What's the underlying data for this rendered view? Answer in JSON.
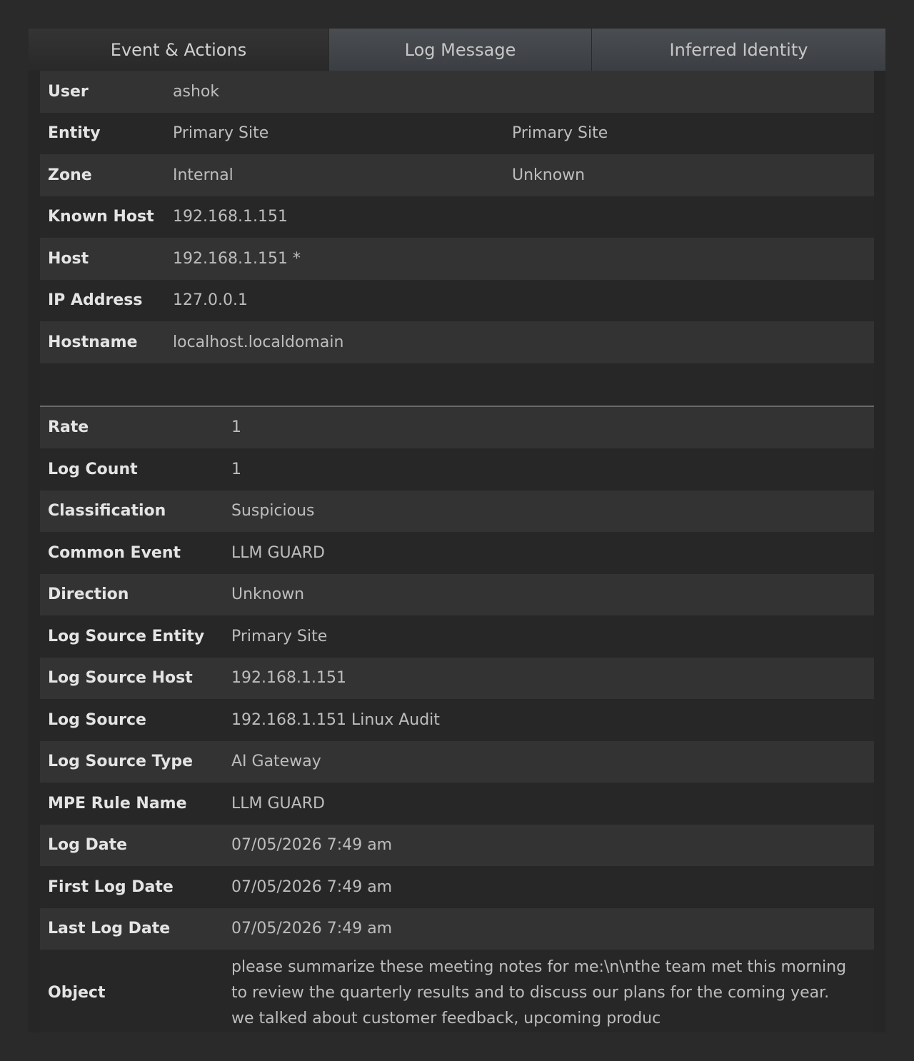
{
  "tabs": [
    {
      "label": "Event & Actions",
      "active": true
    },
    {
      "label": "Log Message",
      "active": false
    },
    {
      "label": "Inferred Identity",
      "active": false
    }
  ],
  "identity": {
    "user": {
      "label": "User",
      "value": "ashok"
    },
    "entity": {
      "label": "Entity",
      "value": "Primary Site",
      "value2": "Primary Site"
    },
    "zone": {
      "label": "Zone",
      "value": "Internal",
      "value2": "Unknown"
    },
    "known_host": {
      "label": "Known Host",
      "value": "192.168.1.151"
    },
    "host": {
      "label": "Host",
      "value": "192.168.1.151 *"
    },
    "ip_address": {
      "label": "IP Address",
      "value": "127.0.0.1"
    },
    "hostname": {
      "label": "Hostname",
      "value": "localhost.localdomain"
    }
  },
  "details": {
    "rate": {
      "label": "Rate",
      "value": "1"
    },
    "log_count": {
      "label": "Log Count",
      "value": "1"
    },
    "classification": {
      "label": "Classification",
      "value": "Suspicious"
    },
    "common_event": {
      "label": "Common Event",
      "value": "LLM GUARD"
    },
    "direction": {
      "label": "Direction",
      "value": "Unknown"
    },
    "log_source_entity": {
      "label": "Log Source Entity",
      "value": "Primary Site"
    },
    "log_source_host": {
      "label": "Log Source Host",
      "value": "192.168.1.151"
    },
    "log_source": {
      "label": "Log Source",
      "value": "192.168.1.151 Linux Audit"
    },
    "log_source_type": {
      "label": "Log Source Type",
      "value": "AI Gateway"
    },
    "mpe_rule_name": {
      "label": "MPE Rule Name",
      "value": "LLM GUARD"
    },
    "log_date": {
      "label": "Log Date",
      "value": "07/05/2026 7:49 am"
    },
    "first_log_date": {
      "label": "First Log Date",
      "value": "07/05/2026 7:49 am"
    },
    "last_log_date": {
      "label": "Last Log Date",
      "value": "07/05/2026 7:49 am"
    },
    "object": {
      "label": "Object",
      "value": "please summarize these meeting notes for me:\\n\\nthe team met this morning to review the quarterly results and to discuss our plans for the coming year. we talked about customer feedback, upcoming produc"
    }
  }
}
